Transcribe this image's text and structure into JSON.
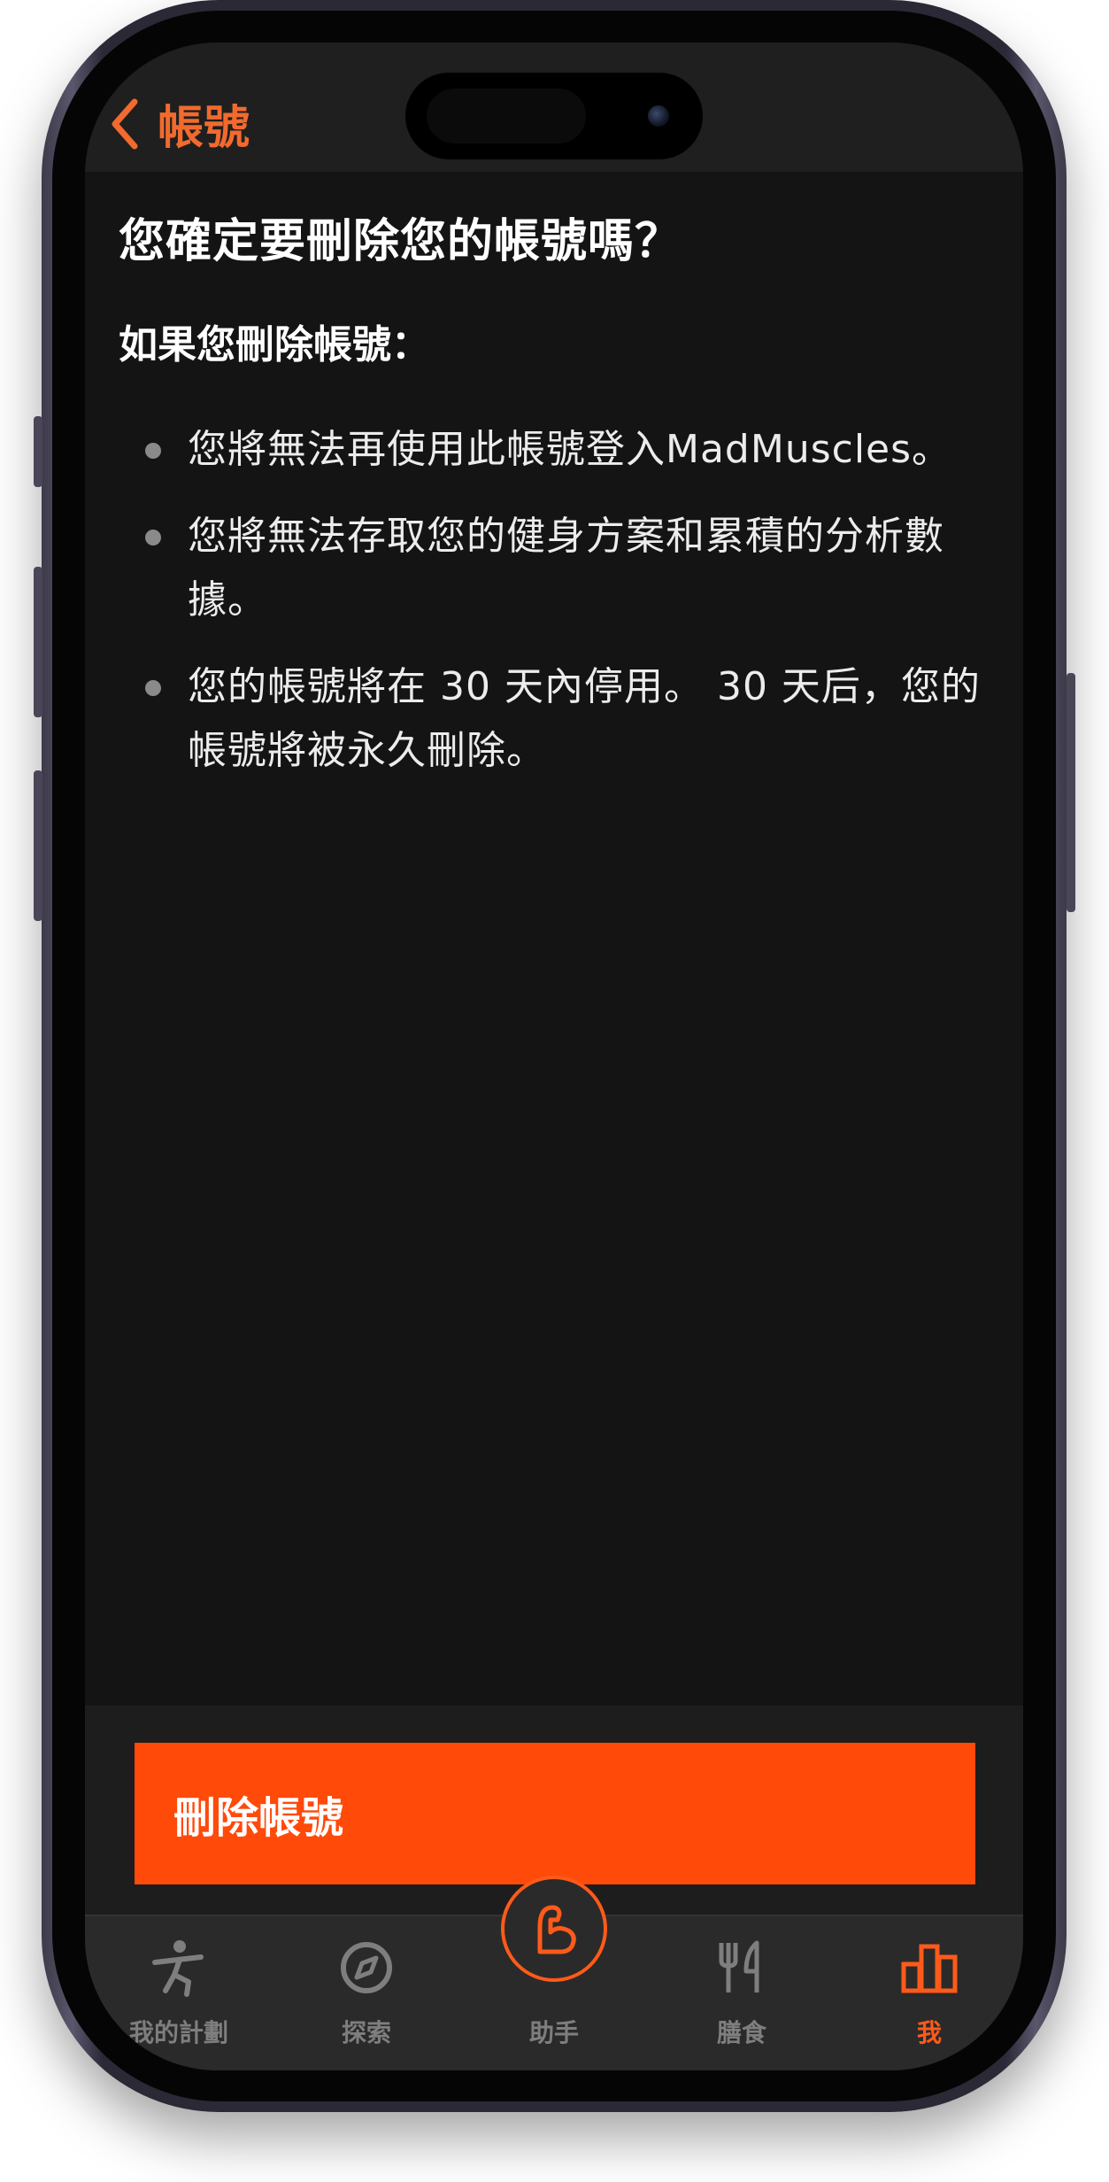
{
  "nav": {
    "back_label": "帳號"
  },
  "content": {
    "title": "您確定要刪除您的帳號嗎？",
    "subtitle": "如果您刪除帳號：",
    "bullets": [
      "您將無法再使用此帳號登入MadMuscles。",
      "您將無法存取您的健身方案和累積的分析數據。",
      "您的帳號將在 30 天內停用。 30 天后，您的帳號將被永久刪除。"
    ]
  },
  "actions": {
    "delete_label": "刪除帳號"
  },
  "tabbar": {
    "tabs": [
      {
        "label": "我的計劃",
        "icon": "person-exercise-icon",
        "active": false
      },
      {
        "label": "探索",
        "icon": "compass-icon",
        "active": false
      },
      {
        "label": "助手",
        "icon": "bicep-icon",
        "active": false
      },
      {
        "label": "膳食",
        "icon": "fork-knife-icon",
        "active": false
      },
      {
        "label": "我",
        "icon": "bar-chart-icon",
        "active": true
      }
    ]
  },
  "colors": {
    "accent": "#ff4a0a",
    "accent_text": "#f26a2e",
    "background": "#141414",
    "tab_inactive": "#7e7e7e"
  }
}
